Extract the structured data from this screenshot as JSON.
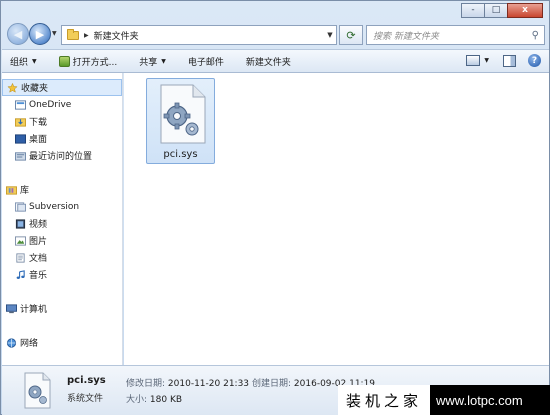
{
  "window": {
    "caption_buttons": [
      "-",
      "□",
      "x"
    ]
  },
  "address_bar": {
    "path": "新建文件夹",
    "search_placeholder": "搜索 新建文件夹"
  },
  "toolbar": {
    "organize": "组织",
    "open_with": "打开方式...",
    "share": "共享",
    "email": "电子邮件",
    "new_folder": "新建文件夹",
    "help": "?"
  },
  "nav_pane": {
    "favorites": {
      "label": "收藏夹",
      "items": [
        "OneDrive",
        "下载",
        "桌面",
        "最近访问的位置"
      ]
    },
    "libraries": {
      "label": "库",
      "items": [
        "Subversion",
        "视频",
        "图片",
        "文档",
        "音乐"
      ]
    },
    "computer": "计算机",
    "network": "网络"
  },
  "content": {
    "files": [
      {
        "name": "pci.sys",
        "icon": "system-file-gear-icon",
        "selected": true
      }
    ]
  },
  "details": {
    "name": "pci.sys",
    "type": "系统文件",
    "modified_label": "修改日期:",
    "modified_value": "2010-11-20 21:33",
    "created_label": "创建日期:",
    "created_value": "2016-09-02 11:19",
    "size_label": "大小:",
    "size_value": "180 KB"
  },
  "watermark": {
    "cn": "装机之家",
    "url": "www.lotpc.com"
  },
  "colors": {
    "selection_fill": "#dcebfc",
    "selection_border": "#9cc2ee",
    "close_button": "#c8452f"
  }
}
